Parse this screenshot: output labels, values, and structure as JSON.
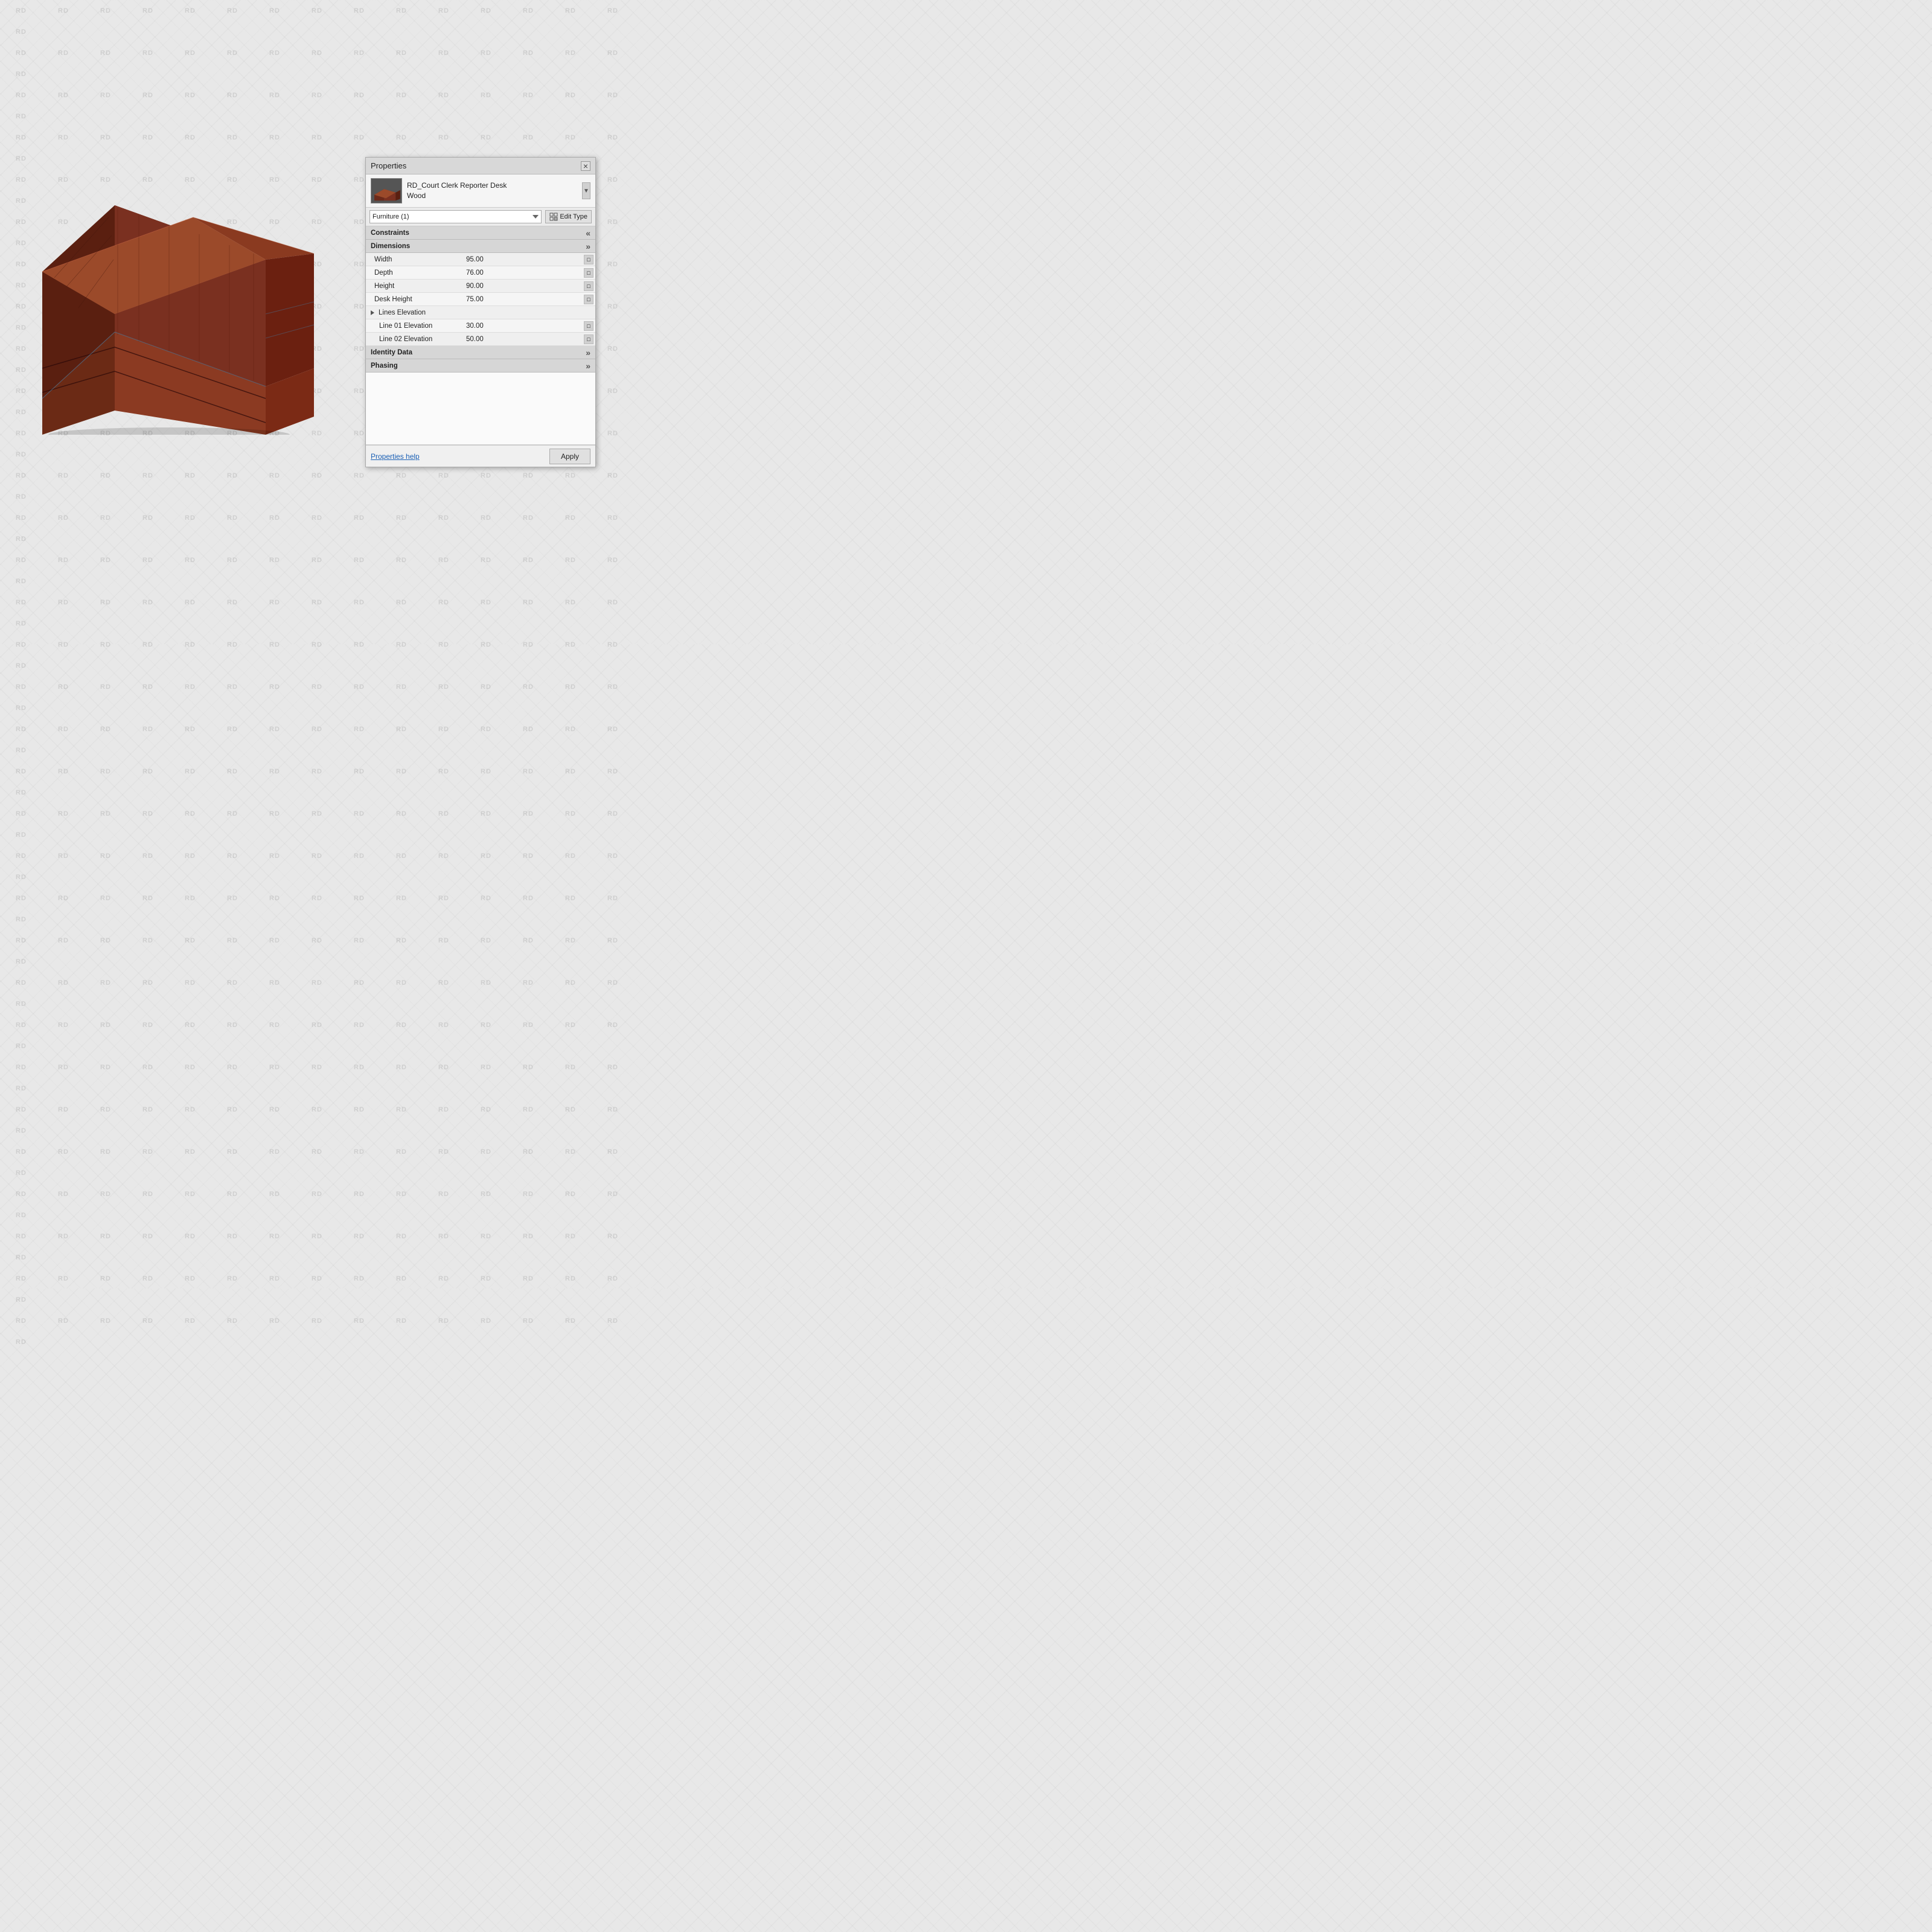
{
  "watermark": {
    "text": "RD",
    "cols": 16,
    "rows": 32
  },
  "panel": {
    "title": "Properties",
    "close_label": "×",
    "scroll_label": "▼",
    "item": {
      "name_line1": "RD_Court Clerk Reporter Desk",
      "name_line2": "Wood"
    },
    "dropdown": {
      "value": "Furniture (1)",
      "options": [
        "Furniture (1)"
      ]
    },
    "edit_type_label": "Edit Type",
    "sections": {
      "constraints": {
        "label": "Constraints",
        "toggle": "«"
      },
      "dimensions": {
        "label": "Dimensions",
        "toggle": "»"
      },
      "identity_data": {
        "label": "Identity Data",
        "toggle": "»"
      },
      "phasing": {
        "label": "Phasing",
        "toggle": "»"
      }
    },
    "properties": {
      "width": {
        "label": "Width",
        "value": "95.00"
      },
      "depth": {
        "label": "Depth",
        "value": "76.00"
      },
      "height": {
        "label": "Height",
        "value": "90.00"
      },
      "desk_height": {
        "label": "Desk Height",
        "value": "75.00"
      },
      "lines_elevation": {
        "label": "Lines Elevation",
        "value": ""
      },
      "line_01_elevation": {
        "label": "Line 01 Elevation",
        "value": "30.00"
      },
      "line_02_elevation": {
        "label": "Line 02 Elevation",
        "value": "50.00"
      }
    },
    "footer": {
      "help_link": "Properties help",
      "apply_label": "Apply"
    }
  }
}
